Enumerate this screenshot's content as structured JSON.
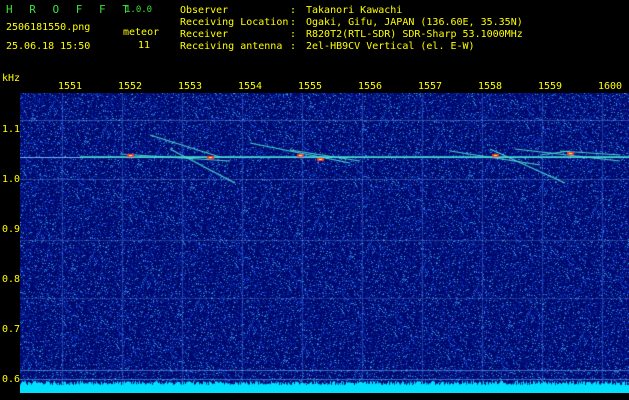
{
  "header": {
    "app_name": "H R O F F T",
    "version": "1.0.0",
    "filename": "2506181550.png",
    "datetime": "25.06.18 15:50",
    "meteor_label": "meteor",
    "meteor_count": "11",
    "info": [
      {
        "label": "Observer",
        "value": "Takanori Kawachi"
      },
      {
        "label": "Receiving Location",
        "value": "Ogaki, Gifu, JAPAN (136.60E, 35.35N)"
      },
      {
        "label": "Receiver",
        "value": "R820T2(RTL-SDR) SDR-Sharp 53.1000MHz"
      },
      {
        "label": "Receiving antenna",
        "value": "2el-HB9CV Vertical (el. E-W)"
      }
    ],
    "separator": ":"
  },
  "spectrogram": {
    "y_unit": "kHz",
    "x_ticks": [
      "1551",
      "1552",
      "1553",
      "1554",
      "1555",
      "1556",
      "1557",
      "1558",
      "1559",
      "1600"
    ],
    "y_ticks": [
      "1.1",
      "1.0",
      "0.9",
      "0.8",
      "0.7",
      "0.6"
    ],
    "colors": {
      "background": "#000a6e",
      "noise": "#2050d0",
      "trace": "#40e0d0",
      "hot": "#ff3030",
      "axis": "#ffff00",
      "baseline": "#00e0ff"
    }
  }
}
